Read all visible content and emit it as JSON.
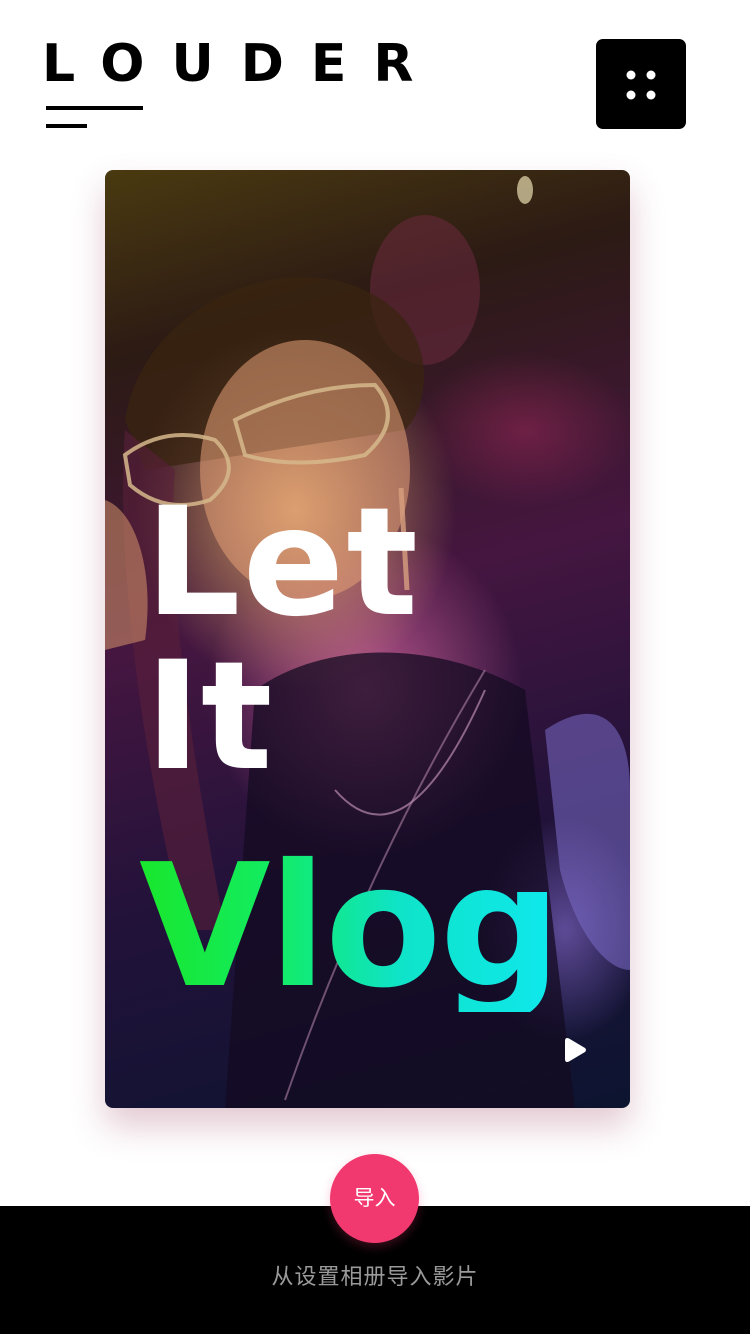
{
  "header": {
    "brand": "LOUDER",
    "menu_icon": "grid-dots-icon"
  },
  "card": {
    "title_line_1": "Let",
    "title_line_2": "It",
    "title_line_3": "Vlog",
    "play_icon": "play-icon"
  },
  "actions": {
    "import_label": "导入",
    "hint": "从设置相册导入影片"
  },
  "colors": {
    "accent": "#f1396f",
    "vlog_gradient_start": "#19e62c",
    "vlog_gradient_end": "#0fe8ee",
    "text_primary": "#000000",
    "bottom_bar": "#000000",
    "hint_text": "#9a9a9a"
  }
}
